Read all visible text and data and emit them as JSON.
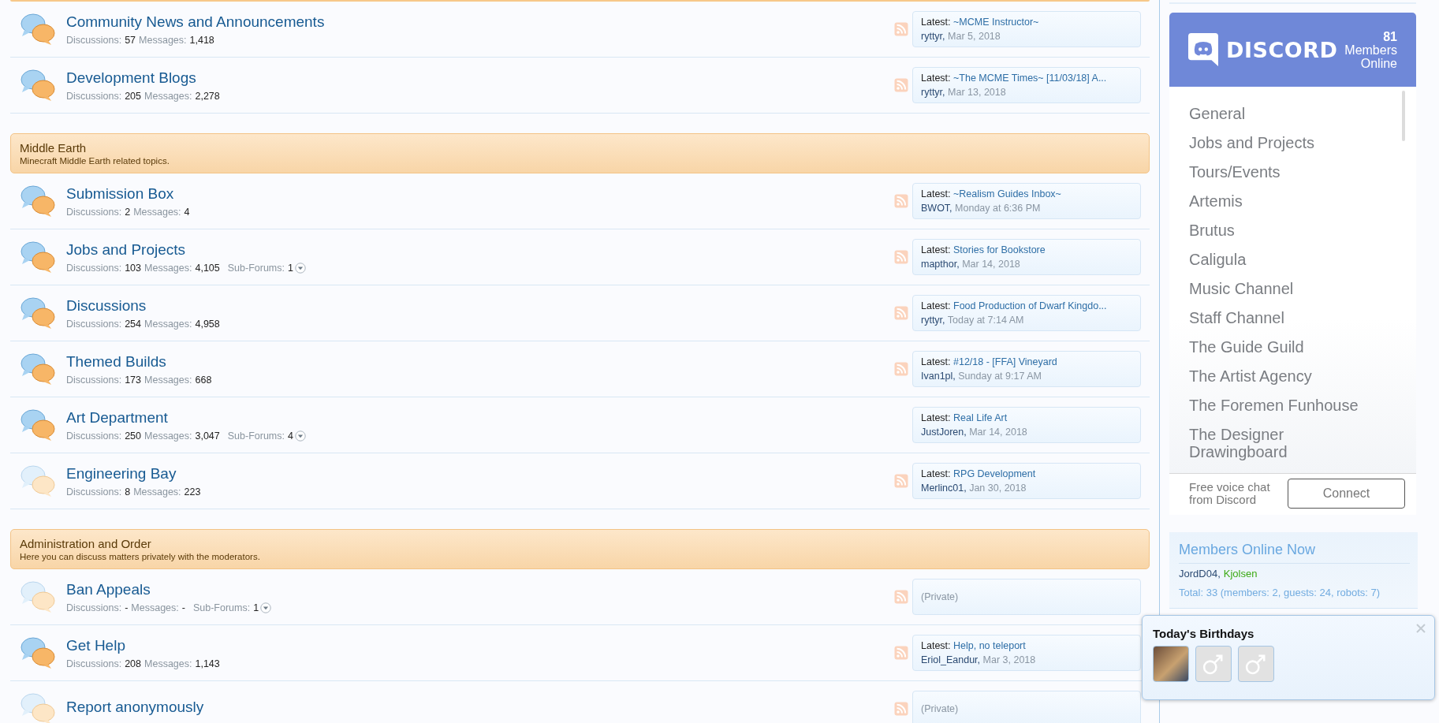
{
  "sections": [
    {
      "forums": [
        {
          "title": "Community News and Announcements",
          "unread": true,
          "stats": [
            {
              "kind": "count",
              "label": "Discussions:",
              "value": "57"
            },
            {
              "kind": "count",
              "label": "Messages:",
              "value": "1,418"
            }
          ],
          "rss": true,
          "latest": {
            "kind": "post",
            "label": "Latest:",
            "title": "~MCME Instructor~",
            "user": "ryttyr,",
            "date": "Mar 5, 2018"
          }
        },
        {
          "title": "Development Blogs",
          "unread": true,
          "stats": [
            {
              "kind": "count",
              "label": "Discussions:",
              "value": "205"
            },
            {
              "kind": "count",
              "label": "Messages:",
              "value": "2,278"
            }
          ],
          "rss": true,
          "latest": {
            "kind": "post",
            "label": "Latest:",
            "title": "~The MCME Times~ [11/03/18] A...",
            "user": "ryttyr,",
            "date": "Mar 13, 2018"
          }
        }
      ]
    },
    {
      "header": {
        "title": "Middle Earth",
        "description": "Minecraft Middle Earth related topics."
      },
      "forums": [
        {
          "title": "Submission Box",
          "unread": true,
          "stats": [
            {
              "kind": "count",
              "label": "Discussions:",
              "value": "2"
            },
            {
              "kind": "count",
              "label": "Messages:",
              "value": "4"
            }
          ],
          "rss": true,
          "latest": {
            "kind": "post",
            "label": "Latest:",
            "title": "~Realism Guides Inbox~",
            "user": "BWOT,",
            "date": "Monday at 6:36 PM"
          }
        },
        {
          "title": "Jobs and Projects",
          "unread": true,
          "stats": [
            {
              "kind": "count",
              "label": "Discussions:",
              "value": "103"
            },
            {
              "kind": "count",
              "label": "Messages:",
              "value": "4,105"
            },
            {
              "kind": "subforums",
              "label": "Sub-Forums:",
              "value": "1"
            }
          ],
          "rss": true,
          "latest": {
            "kind": "post",
            "label": "Latest:",
            "title": "Stories for Bookstore",
            "user": "mapthor,",
            "date": "Mar 14, 2018"
          }
        },
        {
          "title": "Discussions",
          "unread": true,
          "stats": [
            {
              "kind": "count",
              "label": "Discussions:",
              "value": "254"
            },
            {
              "kind": "count",
              "label": "Messages:",
              "value": "4,958"
            }
          ],
          "rss": true,
          "latest": {
            "kind": "post",
            "label": "Latest:",
            "title": "Food Production of Dwarf Kingdo...",
            "user": "ryttyr,",
            "date": "Today at 7:14 AM"
          }
        },
        {
          "title": "Themed Builds",
          "unread": true,
          "stats": [
            {
              "kind": "count",
              "label": "Discussions:",
              "value": "173"
            },
            {
              "kind": "count",
              "label": "Messages:",
              "value": "668"
            }
          ],
          "rss": true,
          "latest": {
            "kind": "post",
            "label": "Latest:",
            "title": "#12/18 - [FFA] Vineyard",
            "user": "Ivan1pl,",
            "date": "Sunday at 9:17 AM"
          }
        },
        {
          "title": "Art Department",
          "unread": true,
          "stats": [
            {
              "kind": "count",
              "label": "Discussions:",
              "value": "250"
            },
            {
              "kind": "count",
              "label": "Messages:",
              "value": "3,047"
            },
            {
              "kind": "subforums",
              "label": "Sub-Forums:",
              "value": "4"
            }
          ],
          "rss": false,
          "latest": {
            "kind": "post",
            "label": "Latest:",
            "title": "Real Life Art",
            "user": "JustJoren,",
            "date": "Mar 14, 2018"
          }
        },
        {
          "title": "Engineering Bay",
          "unread": false,
          "stats": [
            {
              "kind": "count",
              "label": "Discussions:",
              "value": "8"
            },
            {
              "kind": "count",
              "label": "Messages:",
              "value": "223"
            }
          ],
          "rss": true,
          "latest": {
            "kind": "post",
            "label": "Latest:",
            "title": "RPG Development",
            "user": "Merlinc01,",
            "date": "Jan 30, 2018"
          }
        }
      ]
    },
    {
      "header": {
        "title": "Administration and Order",
        "description": "Here you can discuss matters privately with the moderators."
      },
      "forums": [
        {
          "title": "Ban Appeals",
          "unread": false,
          "stats": [
            {
              "kind": "count",
              "label": "Discussions:",
              "value": "-"
            },
            {
              "kind": "count",
              "label": "Messages:",
              "value": "-"
            },
            {
              "kind": "subforums",
              "label": "Sub-Forums:",
              "value": "1"
            }
          ],
          "rss": true,
          "latest": {
            "kind": "private",
            "text": "(Private)"
          }
        },
        {
          "title": "Get Help",
          "unread": true,
          "stats": [
            {
              "kind": "count",
              "label": "Discussions:",
              "value": "208"
            },
            {
              "kind": "count",
              "label": "Messages:",
              "value": "1,143"
            }
          ],
          "rss": true,
          "latest": {
            "kind": "post",
            "label": "Latest:",
            "title": "Help, no teleport",
            "user": "Eriol_Eandur,",
            "date": "Mar 3, 2018"
          }
        },
        {
          "title": "Report anonymously",
          "unread": false,
          "rss": true,
          "latest": {
            "kind": "private",
            "text": "(Private)"
          }
        }
      ]
    }
  ],
  "discord": {
    "brand": "DISCORD",
    "online_count": "81",
    "online_label_1": "Members",
    "online_label_2": "Online",
    "channels": [
      "General",
      "Jobs and Projects",
      "Tours/Events",
      "Artemis",
      "Brutus",
      "Caligula",
      "Music Channel",
      "Staff Channel",
      "The Guide Guild",
      "The Artist Agency",
      "The Foremen Funhouse",
      "The Designer Drawingboard"
    ],
    "footer_text": "Free voice chat from Discord",
    "connect_button": "Connect"
  },
  "members_online": {
    "title": "Members Online Now",
    "members": [
      {
        "text": "JordD04,",
        "color": "#2b4a72"
      },
      {
        "text": "Kjolsen",
        "color": "#3caa14"
      }
    ],
    "total": "Total: 33 (members: 2, guests: 24, robots: 7)"
  },
  "birthdays": {
    "title": "Today's Birthdays",
    "avatars": [
      {
        "kind": "photo"
      },
      {
        "kind": "default"
      },
      {
        "kind": "default"
      }
    ]
  }
}
